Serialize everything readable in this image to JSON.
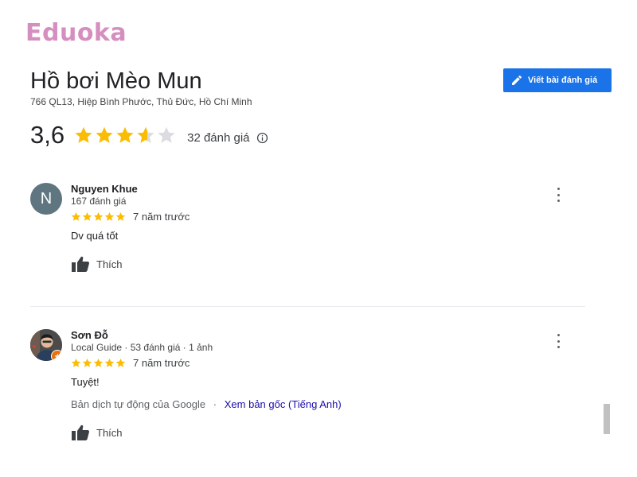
{
  "logo": "Eduoka",
  "place": {
    "title": "Hồ bơi Mèo Mun",
    "address": "766 QL13, Hiệp Bình Phước, Thủ Đức, Hồ Chí Minh"
  },
  "write_review_label": "Viết bài đánh giá",
  "summary": {
    "rating_text": "3,6",
    "rating_value": 3.6,
    "review_count": "32 đánh giá",
    "info_icon": "info-icon"
  },
  "reviews": [
    {
      "avatar_letter": "N",
      "name": "Nguyen Khue",
      "meta": "167 đánh giá",
      "rating": 5,
      "time": "7 năm trước",
      "text": "Dv quá tốt",
      "like_label": "Thích"
    },
    {
      "name": "Sơn Đỗ",
      "meta": "Local Guide · 53 đánh giá · 1 ảnh",
      "rating": 5,
      "time": "7 năm trước",
      "text": "Tuyệt!",
      "translation_note": "Bản dịch tự động của Google",
      "translation_sep": "·",
      "translation_link": "Xem bản gốc (Tiếng Anh)",
      "like_label": "Thích"
    }
  ],
  "colors": {
    "accent": "#1a73e8",
    "star": "#fbbc04",
    "star_empty": "#dadce0",
    "logo": "#d58fbf",
    "link": "#1a0dab",
    "local_guide_badge": "#e8710a"
  }
}
